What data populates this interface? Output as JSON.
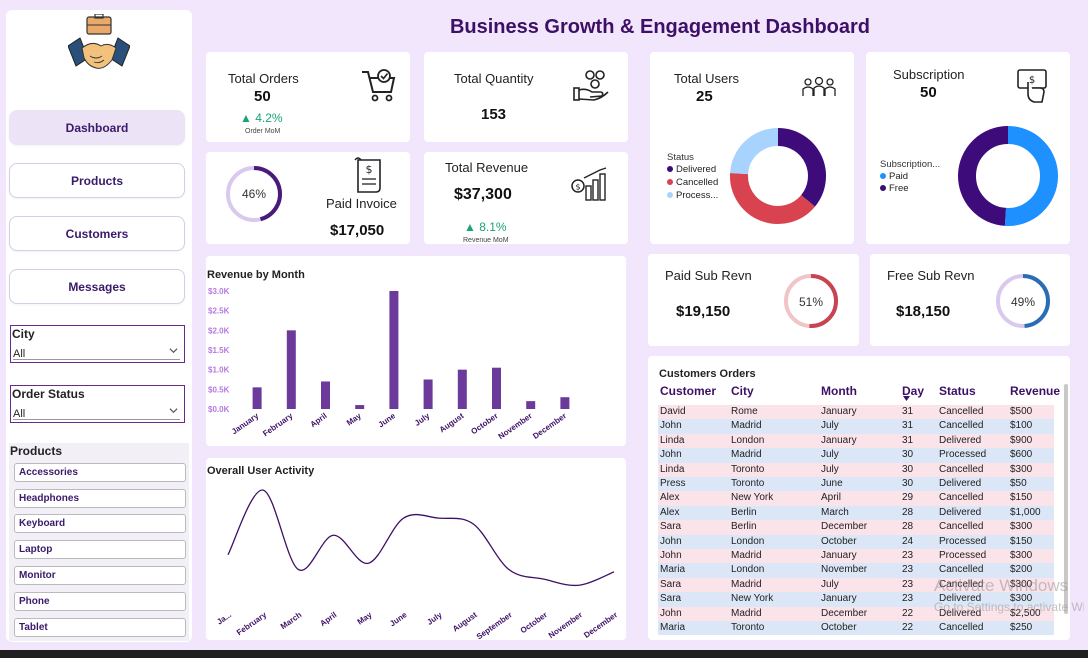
{
  "title": "Business Growth & Engagement Dashboard",
  "nav": [
    {
      "label": "Dashboard",
      "active": true
    },
    {
      "label": "Products",
      "active": false
    },
    {
      "label": "Customers",
      "active": false
    },
    {
      "label": "Messages",
      "active": false
    }
  ],
  "filters": {
    "city": {
      "label": "City",
      "value": "All"
    },
    "order_status": {
      "label": "Order Status",
      "value": "All"
    }
  },
  "products": {
    "title": "Products",
    "items": [
      "Accessories",
      "Headphones",
      "Keyboard",
      "Laptop",
      "Monitor",
      "Phone",
      "Tablet"
    ]
  },
  "kpis": {
    "total_orders": {
      "label": "Total Orders",
      "value": "50",
      "delta": "▲ 4.2%",
      "delta_label": "Order MoM"
    },
    "total_quantity": {
      "label": "Total Quantity",
      "value": "153"
    },
    "paid_invoice": {
      "label": "Paid Invoice",
      "value": "$17,050",
      "pct_label": "46%",
      "pct": 0.46
    },
    "total_revenue": {
      "label": "Total Revenue",
      "value": "$37,300",
      "delta": "▲ 8.1%",
      "delta_label": "Revenue MoM"
    },
    "paid_sub": {
      "label": "Paid Sub Revn",
      "value": "$19,150",
      "pct_label": "51%",
      "pct": 0.51
    },
    "free_sub": {
      "label": "Free Sub Revn",
      "value": "$18,150",
      "pct_label": "49%",
      "pct": 0.49
    }
  },
  "total_users": {
    "label": "Total Users",
    "value": "25",
    "legend_title": "Status",
    "items": [
      {
        "name": "Delivered",
        "value": 9,
        "color": "#3d0c7a"
      },
      {
        "name": "Cancelled",
        "value": 10,
        "color": "#d8434f"
      },
      {
        "name": "Process...",
        "value": 6,
        "color": "#a9d3ff"
      }
    ]
  },
  "subscription": {
    "label": "Subscription",
    "value": "50",
    "legend_title": "Subscription...",
    "items": [
      {
        "name": "Paid",
        "value": 51,
        "color": "#1e90ff"
      },
      {
        "name": "Free",
        "value": 49,
        "color": "#3d0c7a"
      }
    ]
  },
  "colors": {
    "accent": "#3d1066",
    "bar": "#6b3a9a",
    "line": "#3d1066",
    "delta_up": "#1aa37a",
    "paid_ring": "#c84450",
    "free_ring": "#2b6db5",
    "invoice_ring": "#4a1a7a"
  },
  "chart_data": [
    {
      "type": "bar",
      "title": "Revenue by Month",
      "categories": [
        "January",
        "February",
        "April",
        "May",
        "June",
        "July",
        "August",
        "October",
        "November",
        "December"
      ],
      "values": [
        550,
        2000,
        700,
        100,
        3000,
        750,
        1000,
        1050,
        200,
        300
      ],
      "ylim": [
        0,
        3000
      ],
      "yticks": [
        "$0.0K",
        "$0.5K",
        "$1.0K",
        "$1.5K",
        "$2.0K",
        "$2.5K",
        "$3.0K"
      ],
      "grid": false
    },
    {
      "type": "line",
      "title": "Overall User Activity",
      "categories": [
        "Ja...",
        "February",
        "March",
        "April",
        "May",
        "June",
        "July",
        "August",
        "September",
        "October",
        "November",
        "December"
      ],
      "values": [
        42,
        95,
        30,
        58,
        35,
        72,
        72,
        67,
        30,
        22,
        17,
        28
      ],
      "ylim": [
        0,
        100
      ],
      "grid": false
    }
  ],
  "orders_table": {
    "title": "Customers Orders",
    "columns": [
      "Customer",
      "City",
      "Month",
      "Day",
      "Status",
      "Revenue"
    ],
    "rows": [
      [
        "David",
        "Rome",
        "January",
        "31",
        "Cancelled",
        "$500"
      ],
      [
        "John",
        "Madrid",
        "July",
        "31",
        "Cancelled",
        "$100"
      ],
      [
        "Linda",
        "London",
        "January",
        "31",
        "Delivered",
        "$900"
      ],
      [
        "John",
        "Madrid",
        "July",
        "30",
        "Processed",
        "$600"
      ],
      [
        "Linda",
        "Toronto",
        "July",
        "30",
        "Cancelled",
        "$300"
      ],
      [
        "Press",
        "Toronto",
        "June",
        "30",
        "Delivered",
        "$50"
      ],
      [
        "Alex",
        "New York",
        "April",
        "29",
        "Cancelled",
        "$150"
      ],
      [
        "Alex",
        "Berlin",
        "March",
        "28",
        "Delivered",
        "$1,000"
      ],
      [
        "Sara",
        "Berlin",
        "December",
        "28",
        "Cancelled",
        "$300"
      ],
      [
        "John",
        "London",
        "October",
        "24",
        "Processed",
        "$150"
      ],
      [
        "John",
        "Madrid",
        "January",
        "23",
        "Processed",
        "$300"
      ],
      [
        "Maria",
        "London",
        "November",
        "23",
        "Cancelled",
        "$200"
      ],
      [
        "Sara",
        "Madrid",
        "July",
        "23",
        "Cancelled",
        "$300"
      ],
      [
        "Sara",
        "New York",
        "January",
        "23",
        "Delivered",
        "$300"
      ],
      [
        "John",
        "Madrid",
        "December",
        "22",
        "Delivered",
        "$2,500"
      ],
      [
        "Maria",
        "Toronto",
        "October",
        "22",
        "Cancelled",
        "$250"
      ]
    ]
  },
  "watermark": {
    "line1": "Activate Windows",
    "line2": "Go to Settings to activate Windows."
  }
}
